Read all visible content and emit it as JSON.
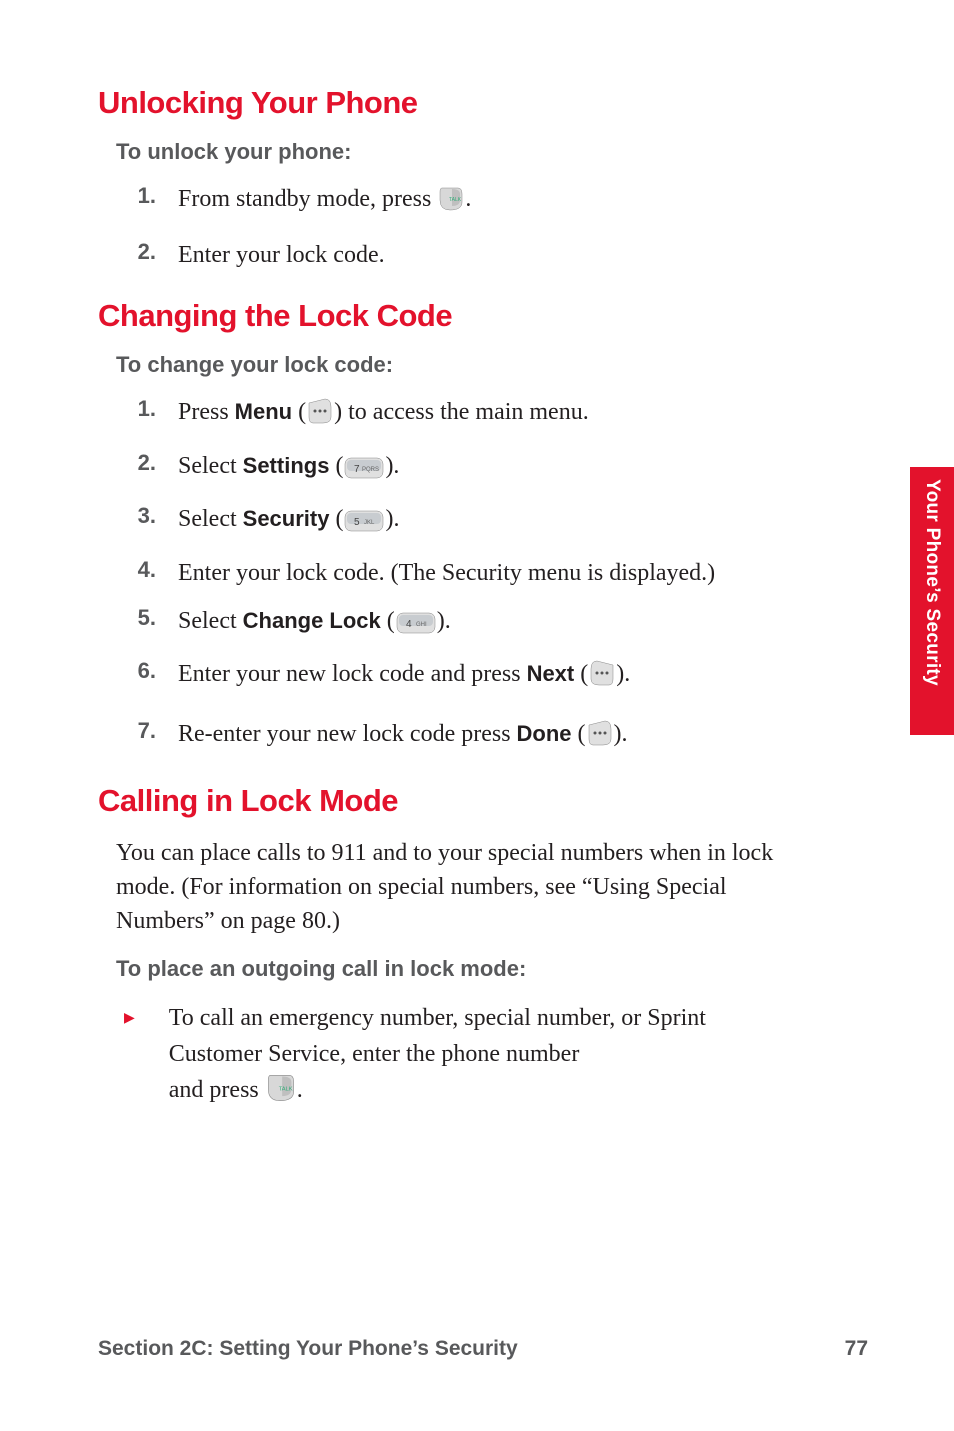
{
  "section1": {
    "heading": "Unlocking Your Phone",
    "sub": "To unlock your phone:",
    "steps": [
      {
        "n": "1.",
        "pre": "From standby mode, press ",
        "post": "."
      },
      {
        "n": "2.",
        "text": "Enter your lock code."
      }
    ]
  },
  "section2": {
    "heading": "Changing the Lock Code",
    "sub": "To change your lock code:",
    "steps": [
      {
        "n": "1.",
        "pre": "Press ",
        "bold": "Menu",
        "mid": " (",
        "post": ") to access the main menu."
      },
      {
        "n": "2.",
        "pre": "Select ",
        "bold": "Settings",
        "mid": " (",
        "post": ")."
      },
      {
        "n": "3.",
        "pre": "Select ",
        "bold": "Security",
        "mid": " (",
        "post": ")."
      },
      {
        "n": "4.",
        "text": "Enter your lock code. (The Security menu is displayed.)"
      },
      {
        "n": "5.",
        "pre": "Select ",
        "bold": "Change Lock",
        "mid": " (",
        "post": ")."
      },
      {
        "n": "6.",
        "pre": "Enter your new lock code and press ",
        "bold": "Next",
        "mid": " (",
        "post": ")."
      },
      {
        "n": "7.",
        "pre": "Re-enter your new lock code press ",
        "bold": "Done",
        "mid": " (",
        "post": ")."
      }
    ]
  },
  "section3": {
    "heading": "Calling in Lock Mode",
    "body": "You can place calls to 911 and to your special numbers when in lock mode. (For information on special numbers, see “Using Special Numbers” on page 80.)",
    "sub": "To place an outgoing call in lock mode:",
    "bullet": {
      "line1": "To call an emergency number, special number, or Sprint Customer Service, enter the phone number",
      "line2_pre": "and press ",
      "line2_post": "."
    }
  },
  "tab": "Your Phone’s Security",
  "footer": {
    "left": "Section 2C: Setting Your Phone’s Security",
    "right": "77"
  },
  "icons": {
    "talk_key": "talk-key-icon",
    "softkey_left_dots": "softkey-left-icon",
    "softkey_right_dots": "softkey-right-icon",
    "key_7pqrs": "key-7-icon",
    "key_5jkl": "key-5-icon",
    "key_4ghi": "key-4-icon"
  }
}
